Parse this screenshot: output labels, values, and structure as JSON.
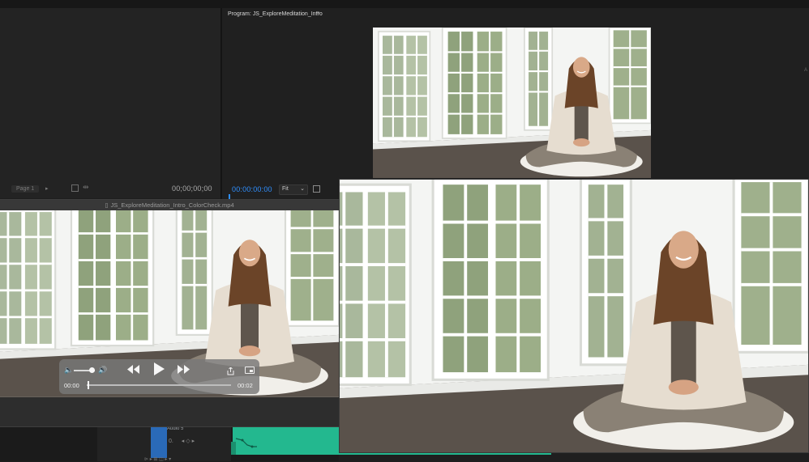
{
  "program_monitor": {
    "tab_title": "Program: JS_ExploreMeditation_Intro",
    "menu_glyph": "≡",
    "timecode": "00:00:00:00",
    "zoom_select": "Fit",
    "chevron": "⌄"
  },
  "source_monitor": {
    "page_label": "Page 1",
    "page_arrow": "▸",
    "timecode": "00;00;00;00"
  },
  "quicktime_player": {
    "window_title": "JS_ExploreMeditation_Intro_ColorCheck.mp4",
    "file_icon_glyph": "▯",
    "controls": {
      "volume_low_glyph": "🔈",
      "volume_high_glyph": "🔊",
      "volume_level": 0.85,
      "rewind_glyph": "◀◀",
      "play_glyph": "▶",
      "fast_forward_glyph": "▶▶",
      "current_time": "00:00",
      "end_time": "00:02",
      "progress": 0.0
    },
    "icons": [
      "speaker-low-icon",
      "speaker-high-icon",
      "rewind-icon",
      "play-icon",
      "fast-forward-icon",
      "share-icon",
      "picture-in-picture-icon"
    ]
  },
  "timeline": {
    "track_name": "Audio 5",
    "track_control": "0.",
    "track_nav": "◂ ◇ ▸",
    "lower_icons": "⊳ ▸ ⊞ ◫ ▸ ▾"
  },
  "colors": {
    "accent_blue": "#2f8fff",
    "clip_green": "#23b88f",
    "track_badge": "#2a6ab8",
    "panel_bg": "#1e1e1e"
  }
}
